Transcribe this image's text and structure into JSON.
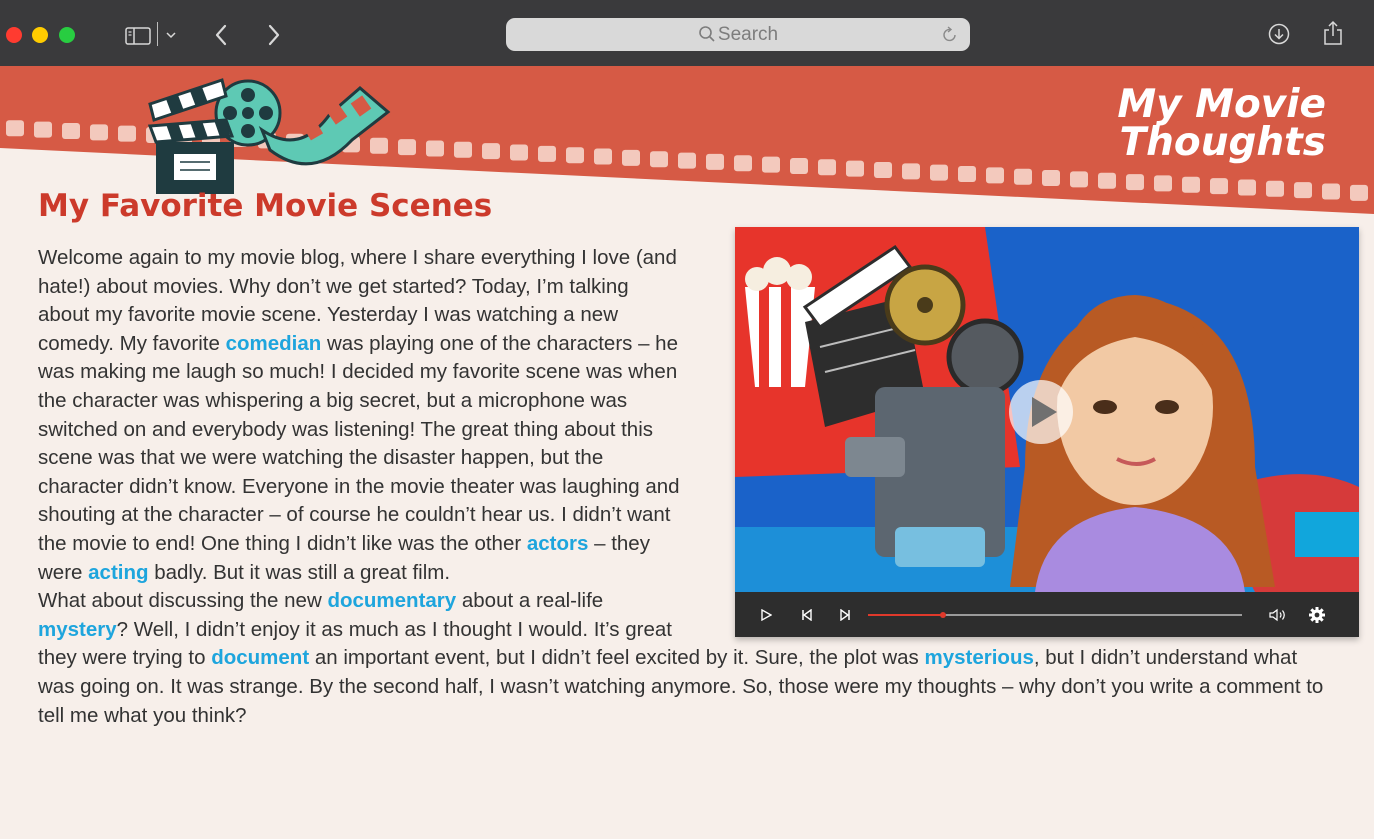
{
  "browser": {
    "search_placeholder": "Search"
  },
  "site": {
    "title_line1": "My Movie",
    "title_line2": "Thoughts"
  },
  "article": {
    "heading": "My Favorite Movie Scenes",
    "p1": [
      {
        "t": "Welcome again to my movie blog, where I share everything I love (and hate!) about movies. Why don’t we get started? Today, I’m talking about my favorite movie scene. Yesterday I was watching a new comedy. My favorite ",
        "k": false
      },
      {
        "t": "comedian",
        "k": true
      },
      {
        "t": " was playing one of the characters – he was making me laugh so much! I decided my favorite scene was when the character was whispering a big secret, but a microphone was switched on and everybody was listening! The great thing about this scene was that we were watching the disaster happen, but the character didn’t know. Everyone in the movie theater was laughing and shouting at the character – of course he couldn’t hear us. I didn’t want the movie to end! One thing I didn’t like was the other ",
        "k": false
      },
      {
        "t": "actors",
        "k": true
      },
      {
        "t": " – they were ",
        "k": false
      },
      {
        "t": "acting",
        "k": true
      },
      {
        "t": " badly. But it was still a great film.",
        "k": false
      }
    ],
    "p2": [
      {
        "t": "What about discussing the new ",
        "k": false
      },
      {
        "t": "documentary",
        "k": true
      },
      {
        "t": " about a real-life ",
        "k": false
      },
      {
        "t": "mystery",
        "k": true
      },
      {
        "t": "? Well, I didn’t enjoy it as much as I thought I would. It’s great they were trying to ",
        "k": false
      },
      {
        "t": "document",
        "k": true
      },
      {
        "t": " an important event, but I didn’t feel excited by it. Sure, the plot was ",
        "k": false
      },
      {
        "t": "mysterious",
        "k": true
      },
      {
        "t": ", but I didn’t understand what was going on. It was strange. By the second half, I wasn’t watching anymore. So, those were my thoughts – why don’t you write a comment to tell me what you think?",
        "k": false
      }
    ]
  },
  "video": {
    "progress": 0.2,
    "icons": [
      "play-icon",
      "skip-back-icon",
      "skip-forward-icon",
      "volume-icon",
      "settings-icon"
    ]
  },
  "colors": {
    "banner": "#d65a45",
    "heading": "#cc3a2b",
    "keyword": "#1ea5dd",
    "progress": "#e0392b"
  }
}
